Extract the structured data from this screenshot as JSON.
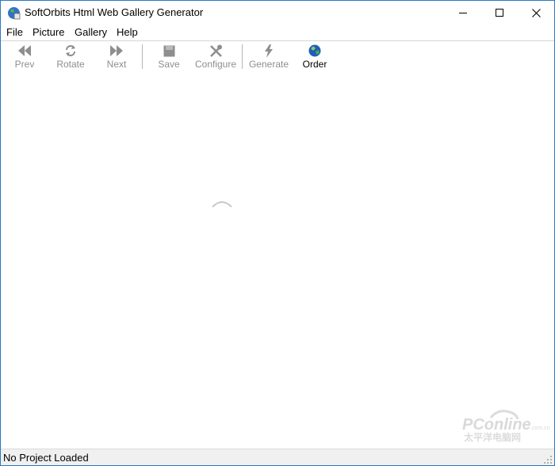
{
  "window": {
    "title": "SoftOrbits Html Web Gallery Generator"
  },
  "menu": {
    "items": [
      "File",
      "Picture",
      "Gallery",
      "Help"
    ]
  },
  "toolbar": {
    "prev_label": "Prev",
    "rotate_label": "Rotate",
    "next_label": "Next",
    "save_label": "Save",
    "configure_label": "Configure",
    "generate_label": "Generate",
    "order_label": "Order"
  },
  "watermark": {
    "text": "PConline",
    "domain": ".com.cn",
    "subtext": "太平洋电脑网"
  },
  "status": {
    "text": "No Project Loaded"
  },
  "colors": {
    "window_border": "#2b79c2",
    "disabled_icon": "#8e8e8e",
    "status_bg": "#f0f0f0"
  }
}
